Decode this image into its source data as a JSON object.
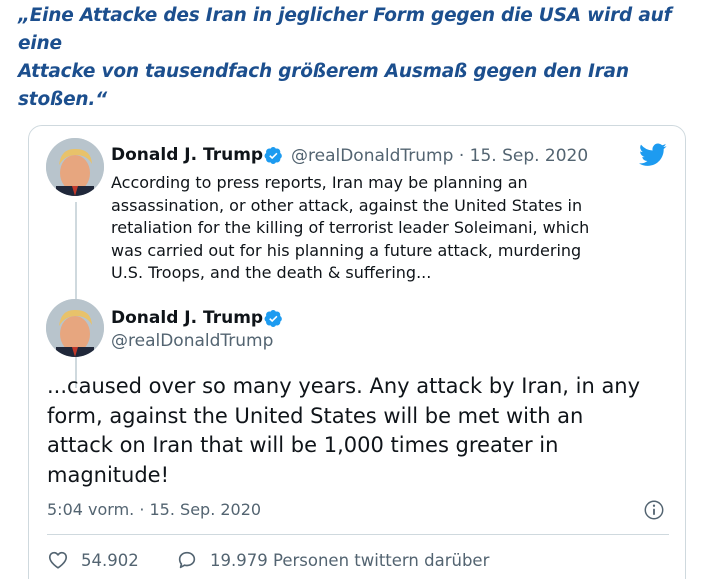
{
  "article": {
    "headline_line1": "„Eine Attacke des Iran in jeglicher Form gegen die USA wird auf eine",
    "headline_line2": "Attacke von tausendfach größerem Ausmaß gegen den Iran stoßen.“"
  },
  "tweet_embed": {
    "icons": {
      "brand": "twitter-bird-icon",
      "verified": "verified-badge-icon",
      "info": "info-icon",
      "like": "heart-icon",
      "reply": "speech-bubble-icon"
    },
    "colors": {
      "twitter_blue": "#1d9bf0",
      "text_secondary": "#536471",
      "headline_blue": "#1c4f8e"
    },
    "quoted": {
      "name": "Donald J. Trump",
      "meta": "@realDonaldTrump · 15. Sep. 2020",
      "lines": [
        "According to press reports, Iran may be planning an",
        "assassination, or other attack, against the United States in",
        "retaliation for the killing of terrorist leader Soleimani, which",
        "was carried out for his planning a future attack, murdering",
        "U.S. Troops, and the death & suffering..."
      ]
    },
    "main": {
      "name": "Donald J. Trump",
      "handle": "@realDonaldTrump",
      "lines": [
        "...caused over so many years. Any attack by Iran, in any",
        "form, against the United States will be met with an",
        "attack on Iran that will be 1,000 times greater in",
        "magnitude!"
      ],
      "timestamp": "5:04 vorm. · 15. Sep. 2020"
    },
    "actions": {
      "likes": "54.902",
      "conversation": "19.979 Personen twittern darüber"
    }
  }
}
